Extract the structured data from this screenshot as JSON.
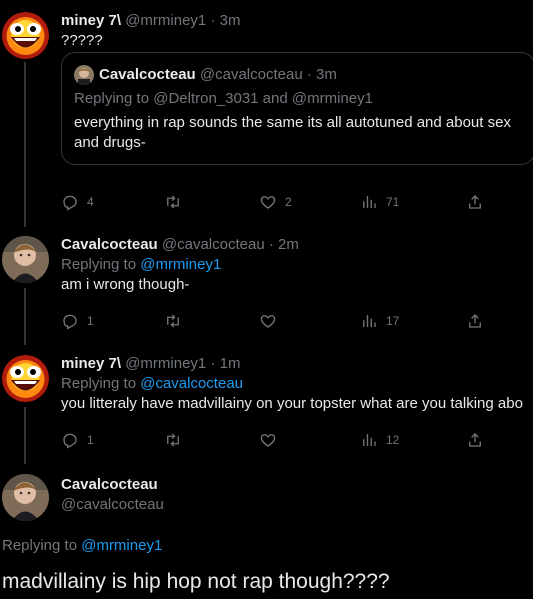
{
  "tweet1": {
    "name": "miney 7\\",
    "handle": "@mrminey1",
    "dot": " · ",
    "time": "3m",
    "text": "?????",
    "quote": {
      "name": "Cavalcocteau",
      "handle": "@cavalcocteau",
      "dot": " · ",
      "time": "3m",
      "replying_prefix": "Replying to ",
      "replying_to_1": "@Deltron_3031",
      "replying_and": " and ",
      "replying_to_2": "@mrminey1",
      "text_line1": "everything in rap sounds the same its all autotuned and about sex",
      "text_line2": "and drugs-"
    },
    "replies": "4",
    "likes": "2",
    "views": "71"
  },
  "tweet2": {
    "name": "Cavalcocteau",
    "handle": "@cavalcocteau",
    "dot": " · ",
    "time": "2m",
    "replying_prefix": "Replying to ",
    "replying_to": "@mrminey1",
    "text": "am i wrong though-",
    "replies": "1",
    "views": "17"
  },
  "tweet3": {
    "name": "miney 7\\",
    "handle": "@mrminey1",
    "dot": " · ",
    "time": "1m",
    "replying_prefix": "Replying to ",
    "replying_to": "@cavalcocteau",
    "text": "you litteraly have madvillainy on your topster what are you talking abo",
    "replies": "1",
    "views": "12"
  },
  "main": {
    "name": "Cavalcocteau",
    "handle": "@cavalcocteau",
    "replying_prefix": "Replying to ",
    "replying_to": "@mrminey1",
    "text": "madvillainy is hip hop not rap though????"
  },
  "colors": {
    "link": "#1d9bf0",
    "muted": "#71767b",
    "text": "#e7e9ea",
    "border": "#333639",
    "background": "#000000"
  },
  "icons": [
    "reply-icon",
    "retweet-icon",
    "like-icon",
    "views-icon",
    "share-icon"
  ]
}
